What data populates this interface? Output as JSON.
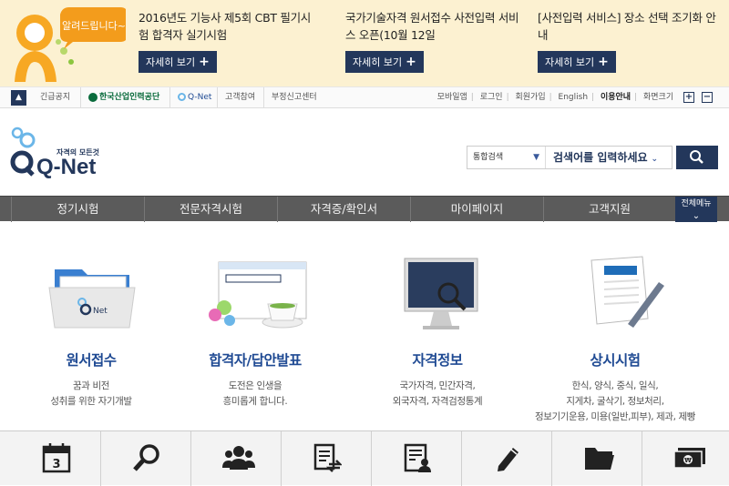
{
  "notices": [
    {
      "text": "2016년도 기능사 제5회 CBT 필기시험 합격자 실기시험",
      "button": "자세히 보기"
    },
    {
      "text": "국가기술자격 원서접수 사전입력 서비스 오픈(10월 12일",
      "button": "자세히 보기"
    },
    {
      "text": "[사전입력 서비스] 장소 선택 조기화 안내",
      "button": "자세히 보기"
    }
  ],
  "mascot_text": "알려드립니다~",
  "util": {
    "links": [
      "긴급공지",
      "한국산업인력공단",
      "Q-Net",
      "고객참여",
      "부정신고센터"
    ],
    "right": [
      "모바일앱",
      "로그인",
      "회원가입",
      "English",
      "이용안내",
      "화면크기"
    ]
  },
  "logo": {
    "tagline": "자격의 모든것",
    "name": "Q-Net"
  },
  "search": {
    "select": "통합검색",
    "placeholder": "검색어를 입력하세요"
  },
  "nav": [
    "정기시험",
    "전문자격시험",
    "자격증/확인서",
    "마이페이지",
    "고객지원"
  ],
  "nav_all": "전체메뉴",
  "services": [
    {
      "title": "원서접수",
      "lines": [
        "꿈과 비전",
        "성취를 위한 자기개발"
      ]
    },
    {
      "title": "합격자/답안발표",
      "lines": [
        "도전은 인생을",
        "흥미롭게 합니다."
      ]
    },
    {
      "title": "자격정보",
      "lines": [
        "국가자격, 민간자격,",
        "외국자격, 자격검정통계"
      ]
    },
    {
      "title": "상시시험",
      "lines": [
        "한식, 양식, 중식, 일식,",
        "지게차, 굴삭기, 정보처리,",
        "정보기기운용, 미용(일반,피부), 제과, 제빵"
      ]
    }
  ],
  "calendar_day": "3",
  "colors": {
    "navy": "#23375b",
    "accent": "#1f4a93",
    "orange": "#f39c1c",
    "nav": "#5b5b5b"
  }
}
